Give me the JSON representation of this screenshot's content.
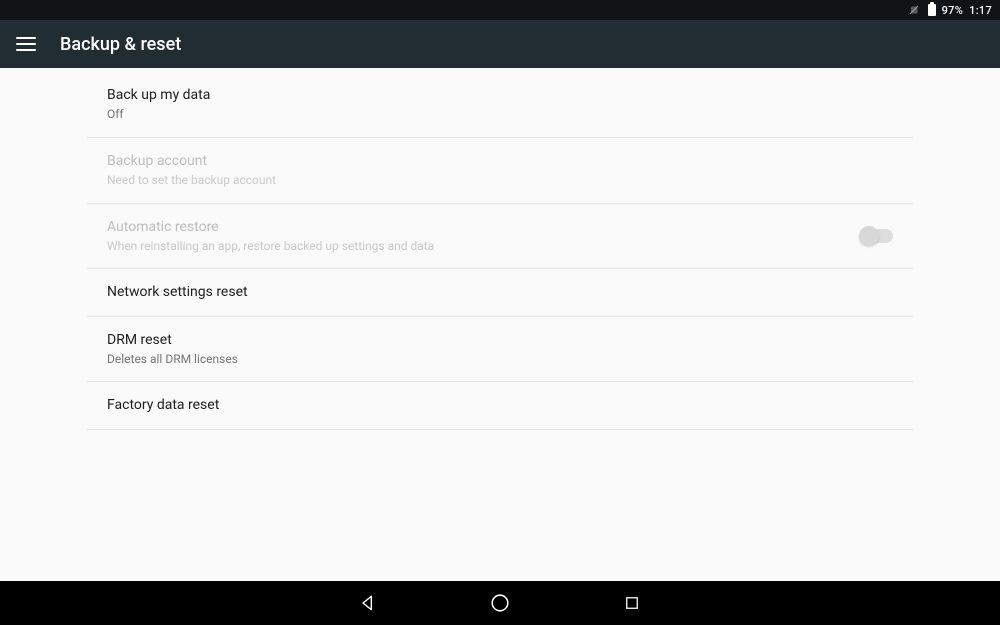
{
  "status": {
    "battery_pct": "97%",
    "clock": "1:17"
  },
  "appbar": {
    "title": "Backup & reset"
  },
  "settings": {
    "backup_data": {
      "title": "Back up my data",
      "sub": "Off"
    },
    "backup_account": {
      "title": "Backup account",
      "sub": "Need to set the backup account"
    },
    "auto_restore": {
      "title": "Automatic restore",
      "sub": "When reinstalling an app, restore backed up settings and data",
      "enabled": false
    },
    "network_reset": {
      "title": "Network settings reset"
    },
    "drm_reset": {
      "title": "DRM reset",
      "sub": "Deletes all DRM licenses"
    },
    "factory_reset": {
      "title": "Factory data reset"
    }
  }
}
